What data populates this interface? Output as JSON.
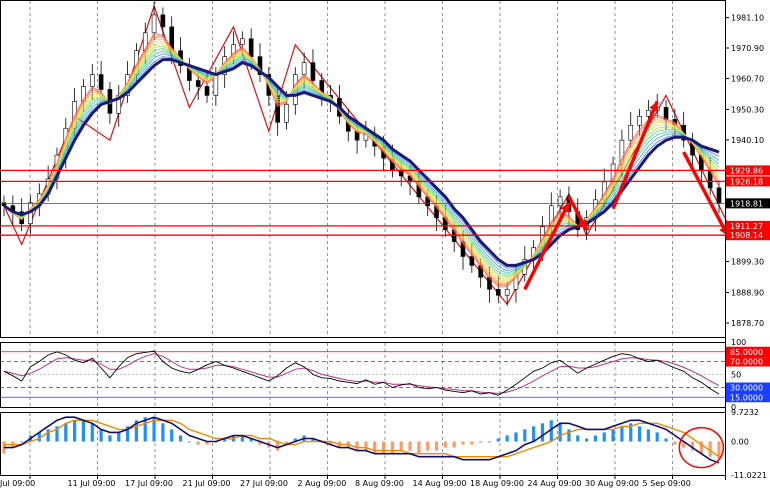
{
  "chart_data": {
    "type": "line",
    "subtype": "candlestick-with-indicators",
    "x_tick_labels": [
      "Jul 09:00",
      "11 Jul 09:00",
      "17 Jul 09:00",
      "21 Jul 09:00",
      "27 Jul 09:00",
      "2 Aug 09:00",
      "8 Aug 09:00",
      "14 Aug 09:00",
      "18 Aug 09:00",
      "24 Aug 09:00",
      "30 Aug 09:00",
      "5 Sep 09:00"
    ],
    "price": {
      "y_ticks": [
        "1981.10",
        "1970.90",
        "1960.70",
        "1950.30",
        "1940.10",
        "1929.86",
        "1926.18",
        "1918.81",
        "1911.27",
        "1908.14",
        "1899.30",
        "1888.90",
        "1878.70"
      ],
      "ylim": [
        1874.0,
        1987.0
      ],
      "grid": true,
      "current_price": 1918.81,
      "levels": [
        {
          "value": 1929.86,
          "label": "1929.86",
          "color": "#ff0000"
        },
        {
          "value": 1926.18,
          "label": "1926.18",
          "color": "#ff0000"
        },
        {
          "value": 1911.27,
          "label": "1911.27",
          "color": "#ff0000"
        },
        {
          "value": 1908.14,
          "label": "1908.14",
          "color": "#ff0000"
        }
      ],
      "close_path": [
        1918,
        1916,
        1912,
        1919,
        1922,
        1927,
        1935,
        1944,
        1953,
        1958,
        1962,
        1957,
        1949,
        1955,
        1962,
        1970,
        1976,
        1982,
        1978,
        1970,
        1965,
        1960,
        1958,
        1955,
        1962,
        1968,
        1972,
        1974,
        1968,
        1962,
        1955,
        1946,
        1952,
        1962,
        1966,
        1960,
        1955,
        1954,
        1948,
        1943,
        1940,
        1942,
        1938,
        1934,
        1930,
        1928,
        1926,
        1921,
        1918,
        1914,
        1910,
        1906,
        1901,
        1898,
        1894,
        1890,
        1888,
        1890,
        1895,
        1900,
        1904,
        1911,
        1918,
        1921,
        1916,
        1910,
        1914,
        1920,
        1926,
        1932,
        1940,
        1945,
        1948,
        1950,
        1951,
        1947,
        1945,
        1940,
        1935,
        1930,
        1924,
        1919
      ],
      "ma_slow_path": [
        1918,
        1916,
        1915,
        1916,
        1918,
        1922,
        1928,
        1934,
        1940,
        1945,
        1949,
        1952,
        1953,
        1954,
        1956,
        1959,
        1962,
        1965,
        1967,
        1967,
        1966,
        1965,
        1964,
        1963,
        1962,
        1963,
        1964,
        1966,
        1965,
        1963,
        1961,
        1958,
        1955,
        1955,
        1956,
        1955,
        1954,
        1953,
        1951,
        1948,
        1946,
        1944,
        1942,
        1940,
        1937,
        1935,
        1933,
        1930,
        1927,
        1924,
        1921,
        1917,
        1914,
        1910,
        1906,
        1903,
        1900,
        1898,
        1898,
        1899,
        1900,
        1902,
        1905,
        1908,
        1910,
        1911,
        1912,
        1914,
        1916,
        1919,
        1923,
        1927,
        1931,
        1935,
        1938,
        1940,
        1941,
        1941,
        1940,
        1938,
        1937,
        1936
      ],
      "ma_fast_path": [
        1917,
        1915,
        1914,
        1916,
        1919,
        1924,
        1931,
        1939,
        1946,
        1952,
        1956,
        1956,
        1954,
        1955,
        1958,
        1963,
        1968,
        1973,
        1974,
        1972,
        1969,
        1966,
        1963,
        1961,
        1962,
        1965,
        1968,
        1970,
        1968,
        1965,
        1960,
        1954,
        1953,
        1957,
        1960,
        1959,
        1957,
        1955,
        1951,
        1947,
        1944,
        1942,
        1940,
        1937,
        1934,
        1931,
        1929,
        1926,
        1922,
        1919,
        1915,
        1911,
        1907,
        1903,
        1899,
        1895,
        1892,
        1891,
        1893,
        1896,
        1900,
        1905,
        1910,
        1914,
        1914,
        1912,
        1913,
        1916,
        1920,
        1925,
        1931,
        1937,
        1942,
        1946,
        1948,
        1948,
        1947,
        1944,
        1941,
        1937,
        1932,
        1927
      ],
      "zigzag": [
        [
          0,
          1918
        ],
        [
          2,
          1905
        ],
        [
          8,
          1948
        ],
        [
          12,
          1940
        ],
        [
          17,
          1985
        ],
        [
          21,
          1951
        ],
        [
          26,
          1978
        ],
        [
          30,
          1943
        ],
        [
          33,
          1972
        ],
        [
          57,
          1885
        ],
        [
          64,
          1922
        ],
        [
          66,
          1908
        ],
        [
          75,
          1955
        ],
        [
          82,
          1912
        ]
      ],
      "arrows": [
        {
          "from": [
            59,
            1890
          ],
          "to": [
            64,
            1919
          ],
          "color": "#ff0000"
        },
        {
          "from": [
            64,
            1921
          ],
          "to": [
            66,
            1910
          ],
          "color": "#ff0000"
        },
        {
          "from": [
            69,
            1917
          ],
          "to": [
            74,
            1953
          ],
          "color": "#ff0000"
        },
        {
          "from": [
            77,
            1936
          ],
          "to": [
            82,
            1908
          ],
          "color": "#ff0000"
        }
      ]
    },
    "rsi": {
      "y_ticks": [
        "100",
        "85.0000",
        "70.0000",
        "50",
        "30.0000",
        "15.0000",
        "0"
      ],
      "ylim": [
        0,
        100
      ],
      "levels": [
        85,
        70,
        30,
        15
      ],
      "rsi_path": [
        55,
        48,
        40,
        62,
        70,
        80,
        85,
        80,
        72,
        68,
        75,
        60,
        45,
        62,
        76,
        82,
        84,
        86,
        70,
        60,
        55,
        52,
        58,
        65,
        70,
        64,
        60,
        55,
        50,
        45,
        40,
        48,
        60,
        68,
        62,
        50,
        45,
        44,
        40,
        38,
        36,
        42,
        35,
        38,
        30,
        34,
        36,
        30,
        28,
        30,
        26,
        24,
        22,
        25,
        20,
        22,
        18,
        26,
        35,
        45,
        55,
        60,
        68,
        72,
        62,
        52,
        60,
        66,
        72,
        78,
        82,
        80,
        74,
        70,
        72,
        66,
        60,
        55,
        45,
        38,
        28,
        20
      ],
      "signal_path": [
        55,
        52,
        48,
        52,
        58,
        66,
        74,
        76,
        74,
        72,
        72,
        66,
        58,
        58,
        64,
        72,
        78,
        82,
        78,
        70,
        62,
        58,
        58,
        60,
        64,
        64,
        62,
        58,
        54,
        50,
        46,
        46,
        52,
        58,
        60,
        56,
        50,
        47,
        44,
        41,
        39,
        40,
        38,
        38,
        35,
        35,
        35,
        33,
        31,
        30,
        28,
        27,
        25,
        25,
        23,
        22,
        21,
        23,
        27,
        33,
        40,
        48,
        55,
        62,
        63,
        60,
        60,
        62,
        66,
        70,
        74,
        76,
        75,
        73,
        72,
        70,
        66,
        61,
        55,
        48,
        40,
        33
      ]
    },
    "macd": {
      "y_ticks": [
        "9.7232",
        "0.00",
        "-11.0221"
      ],
      "ylim": [
        -11.0221,
        9.7232
      ],
      "histogram": [
        -4,
        -2,
        0,
        2,
        3,
        4,
        5,
        6,
        7,
        7,
        6,
        4,
        2,
        3,
        5,
        7,
        8,
        8,
        6,
        4,
        2,
        0,
        -1,
        -1,
        0,
        1,
        2,
        2,
        1,
        -1,
        -2,
        -3,
        -1,
        1,
        2,
        1,
        0,
        -1,
        -2,
        -2,
        -3,
        -3,
        -4,
        -4,
        -4,
        -3,
        -3,
        -4,
        -3,
        -3,
        -2,
        -2,
        -1,
        -1,
        0,
        0,
        1,
        2,
        3,
        4,
        5,
        6,
        7,
        6,
        4,
        2,
        1,
        2,
        3,
        4,
        5,
        6,
        5,
        4,
        3,
        1,
        -1,
        -2,
        -3,
        -4,
        -5,
        -6
      ],
      "macd_path": [
        -2,
        -2,
        -1,
        1,
        3,
        5,
        7,
        8,
        8,
        7,
        6,
        4,
        3,
        3,
        4,
        6,
        7,
        8,
        7,
        6,
        4,
        2,
        1,
        0,
        0,
        1,
        2,
        2,
        1,
        0,
        -1,
        -2,
        -1,
        0,
        1,
        1,
        0,
        -1,
        -2,
        -2,
        -3,
        -3,
        -4,
        -4,
        -4,
        -4,
        -4,
        -5,
        -5,
        -5,
        -5,
        -5,
        -6,
        -6,
        -6,
        -6,
        -5,
        -4,
        -3,
        -1,
        0,
        2,
        4,
        6,
        6,
        5,
        4,
        4,
        4,
        5,
        6,
        7,
        7,
        6,
        5,
        4,
        2,
        0,
        -2,
        -4,
        -6,
        -7
      ],
      "signal_path": [
        -1,
        -1,
        -1,
        0,
        1,
        3,
        4,
        6,
        7,
        7,
        7,
        6,
        5,
        4,
        4,
        5,
        6,
        7,
        7,
        7,
        6,
        4,
        3,
        2,
        1,
        1,
        1,
        2,
        2,
        1,
        1,
        0,
        -1,
        -1,
        0,
        0,
        0,
        0,
        -1,
        -1,
        -2,
        -2,
        -3,
        -3,
        -3,
        -3,
        -4,
        -4,
        -4,
        -4,
        -4,
        -5,
        -5,
        -5,
        -5,
        -5,
        -5,
        -5,
        -4,
        -3,
        -2,
        -1,
        0,
        2,
        3,
        4,
        4,
        4,
        4,
        4,
        5,
        5,
        6,
        6,
        6,
        5,
        4,
        3,
        1,
        -1,
        -3,
        -5
      ]
    }
  }
}
